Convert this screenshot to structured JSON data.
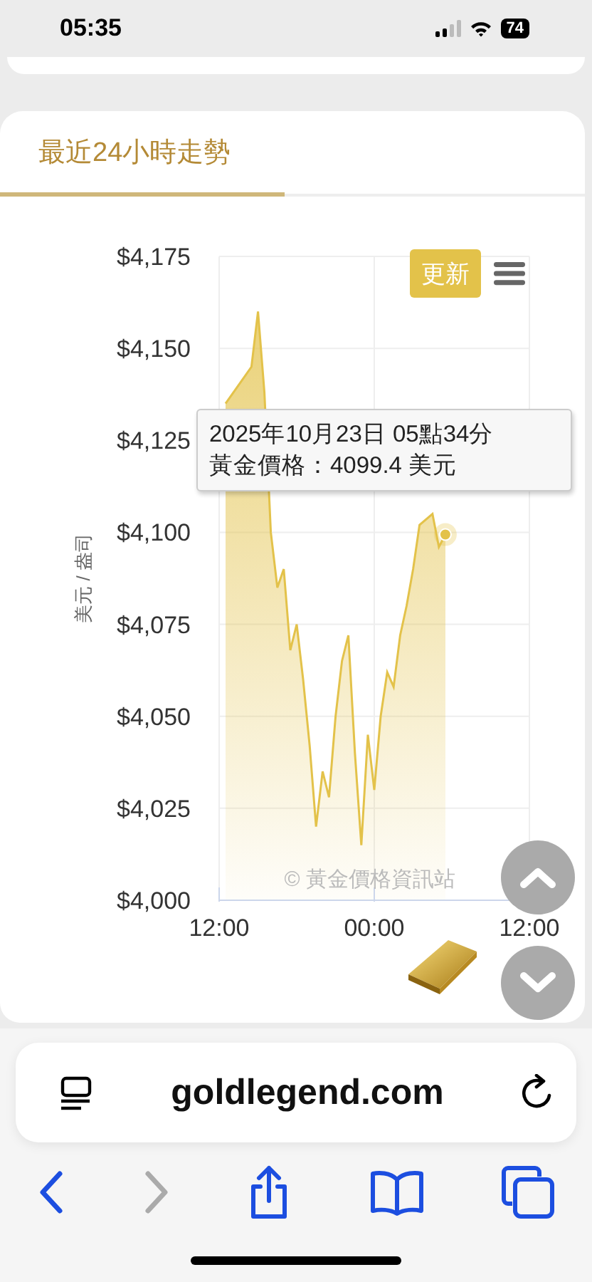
{
  "status_bar": {
    "time": "05:35",
    "battery": "74"
  },
  "tabs": [
    {
      "label": "最近24小時走勢",
      "selected": true
    }
  ],
  "chart": {
    "update_button": "更新",
    "tooltip": [
      "2025年10月23日 05點34分",
      "黃金價格：4099.4 美元"
    ],
    "credit": "© 黃金價格資訊站",
    "chart_data": {
      "type": "area",
      "ylabel": "美元 / 盎司",
      "categories": [
        "12:00",
        null,
        null,
        null,
        null,
        null,
        null,
        null,
        null,
        null,
        null,
        null,
        null,
        null,
        null,
        null,
        null,
        null,
        null,
        null,
        null,
        null,
        null,
        null,
        "00:00",
        null,
        null,
        null,
        null,
        null,
        null,
        null,
        null,
        null,
        null,
        null,
        null,
        null,
        null,
        null,
        null,
        null,
        null,
        null,
        null,
        null,
        null,
        null,
        "12:00"
      ],
      "series": [
        {
          "color": "#e3c24a",
          "values": [
            null,
            4135,
            null,
            4140,
            null,
            4145,
            4160,
            4138,
            4100,
            4085,
            4090,
            4068,
            4075,
            4060,
            4042,
            4020,
            4035,
            4028,
            4050,
            4065,
            4072,
            4040,
            4015,
            4045,
            4030,
            4050,
            4062,
            4058,
            4072,
            4080,
            4090,
            4102,
            null,
            4105,
            4096,
            4099.4,
            null,
            null,
            null,
            null,
            null,
            null,
            null,
            null,
            null,
            null,
            null,
            null,
            null
          ]
        }
      ],
      "grid": true,
      "ylim": [
        4000,
        4175
      ],
      "yticks": [
        {
          "value": 4000,
          "label": "$4,000"
        },
        {
          "value": 4025,
          "label": "$4,025"
        },
        {
          "value": 4050,
          "label": "$4,050"
        },
        {
          "value": 4075,
          "label": "$4,075"
        },
        {
          "value": 4100,
          "label": "$4,100"
        },
        {
          "value": 4125,
          "label": "$4,125"
        },
        {
          "value": 4150,
          "label": "$4,150"
        },
        {
          "value": 4175,
          "label": "$4,175"
        }
      ]
    }
  },
  "browser": {
    "url": "goldlegend.com",
    "back": {
      "disabled": false
    },
    "forward": {
      "disabled": true
    }
  }
}
